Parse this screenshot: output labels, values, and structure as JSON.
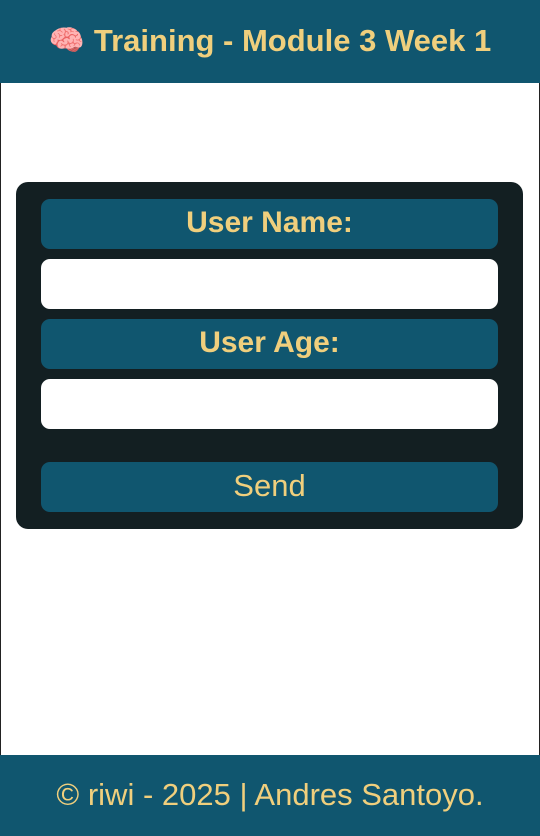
{
  "header": {
    "icon": "🧠",
    "icon_name": "brain-icon",
    "title": "Training - Module 3 Week 1"
  },
  "form": {
    "name_label": "User Name:",
    "name_value": "",
    "age_label": "User Age:",
    "age_value": "",
    "send_label": "Send"
  },
  "footer": {
    "text": "© riwi - 2025 | Andres Santoyo."
  },
  "colors": {
    "primary": "#10566f",
    "accent_text": "#f0cf7d",
    "card_background": "#131f22",
    "page_background": "#ffffff"
  }
}
